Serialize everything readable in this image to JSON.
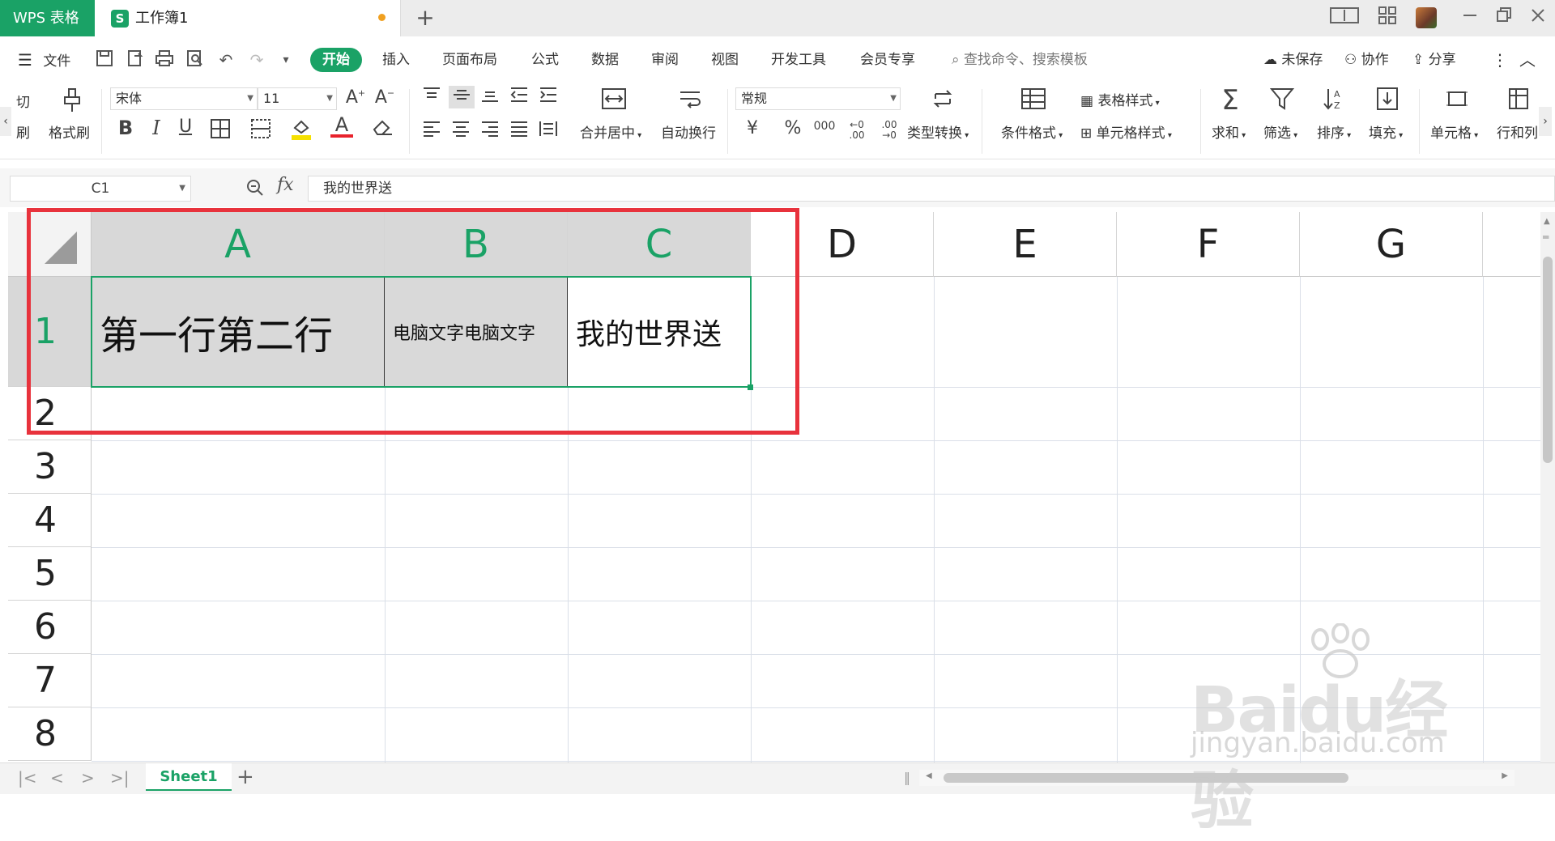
{
  "window": {
    "app_tab": "WPS 表格",
    "doc_icon_letter": "S",
    "doc_title": "工作簿1",
    "new_tab": "+",
    "title_icons": [
      "reading-mode-icon",
      "grid-view-icon",
      "avatar",
      "minimize-icon",
      "restore-icon",
      "close-icon"
    ]
  },
  "menubar": {
    "file": "文件",
    "tabs": [
      "开始",
      "插入",
      "页面布局",
      "公式",
      "数据",
      "审阅",
      "视图",
      "开发工具",
      "会员专享"
    ],
    "search_placeholder": "查找命令、搜索模板",
    "unsaved": "未保存",
    "collab": "协作",
    "share": "分享"
  },
  "ribbon": {
    "clip_partial_top": "切",
    "clip_partial_bottom": "刷",
    "format_painter": "格式刷",
    "font_name": "宋体",
    "font_size": "11",
    "merge_center": "合并居中",
    "auto_wrap": "自动换行",
    "number_format": "常规",
    "type_convert": "类型转换",
    "cond_format": "条件格式",
    "table_style": "表格样式",
    "cell_style": "单元格样式",
    "sum": "求和",
    "filter": "筛选",
    "sort": "排序",
    "fill": "填充",
    "cell": "单元格",
    "row_col": "行和列",
    "currency": "¥",
    "percent": "%",
    "thousands": "000",
    "dec_inc": "←0 .00",
    "dec_dec": ".00 →0"
  },
  "formula_bar": {
    "name_box": "C1",
    "fx": "fx",
    "content": "我的世界送"
  },
  "grid": {
    "columns": [
      "A",
      "B",
      "C",
      "D",
      "E",
      "F",
      "G"
    ],
    "rows": [
      "1",
      "2",
      "3",
      "4",
      "5",
      "6",
      "7",
      "8"
    ],
    "cells": {
      "A1": "第一行第二行",
      "B1": "电脑文字电脑文字",
      "C1": "我的世界送"
    }
  },
  "sheets": {
    "tabs": [
      "Sheet1"
    ],
    "add": "+"
  },
  "watermark": {
    "logo": "Baidu经验",
    "sub": "jingyan.baidu.com"
  },
  "colors": {
    "accent": "#1aa266",
    "highlight_box": "#e8323c",
    "selected_fill": "#d9d9d9"
  }
}
